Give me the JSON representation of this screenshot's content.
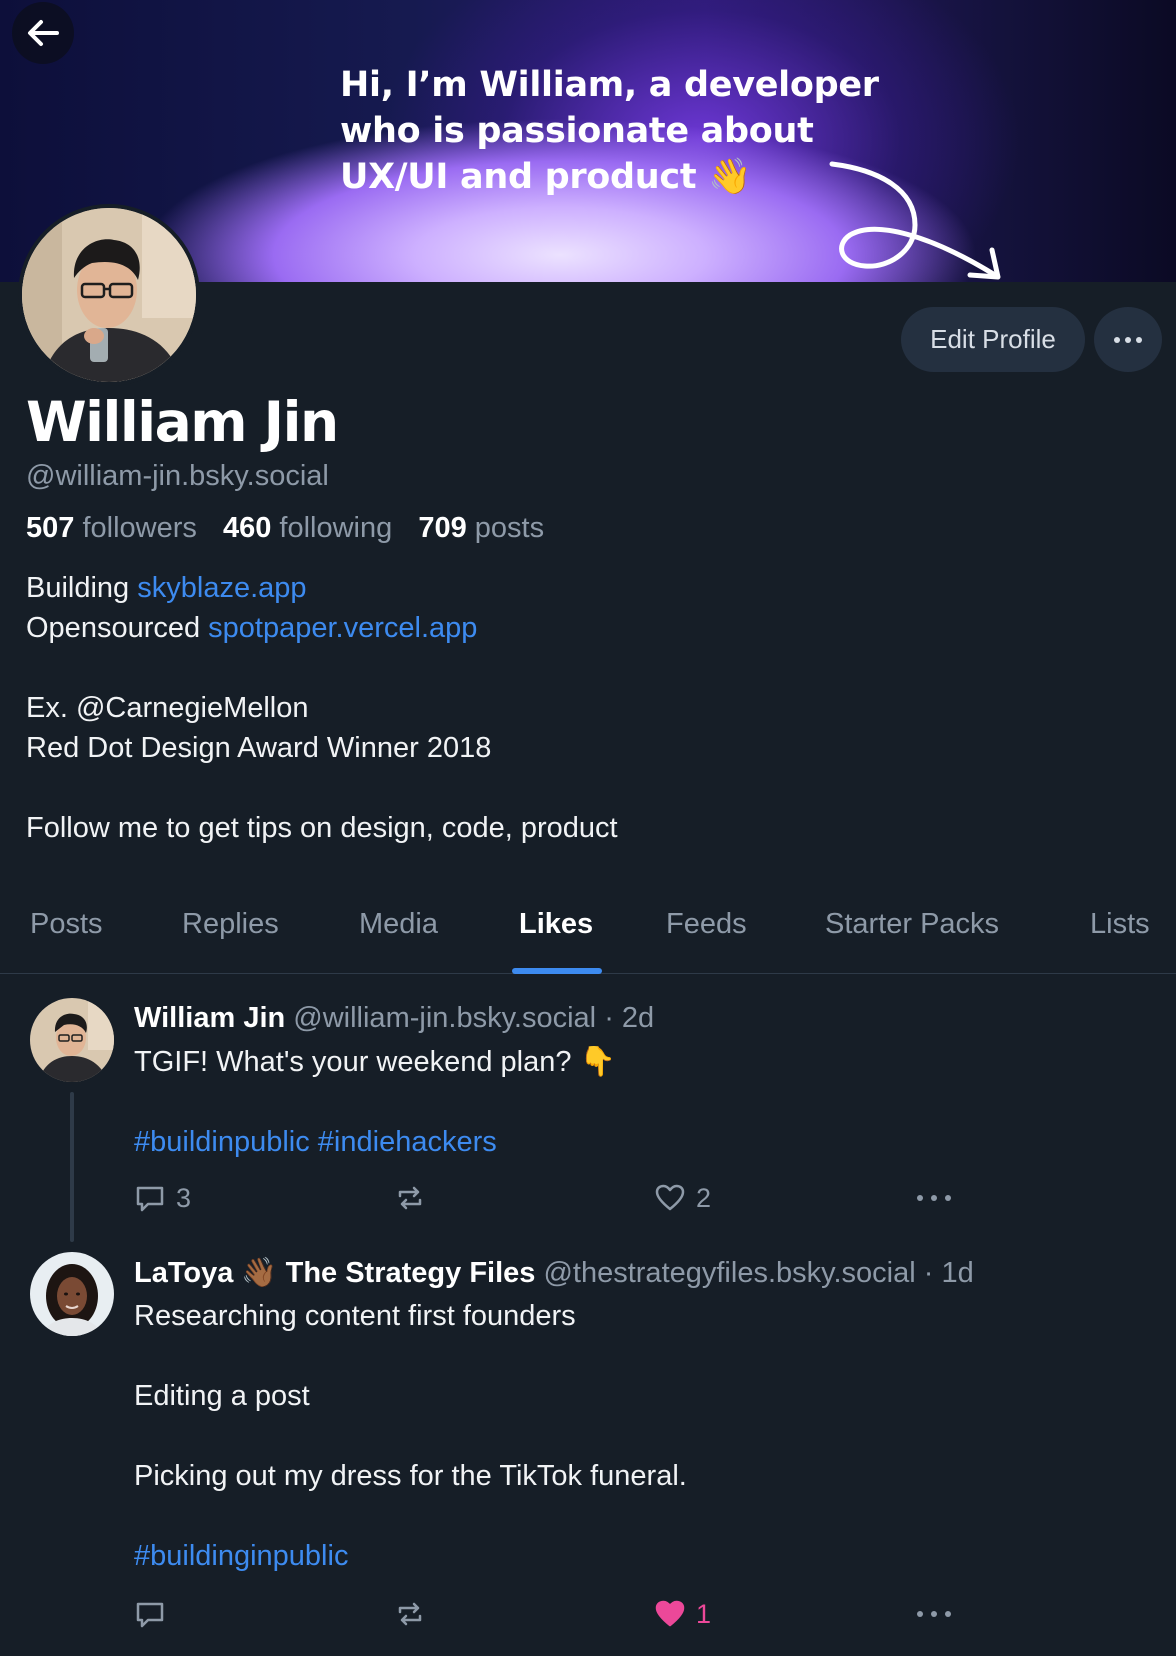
{
  "banner": {
    "text": "Hi, I’m William, a developer\nwho is passionate about\nUX/UI and product 👋"
  },
  "profile": {
    "name": "William Jin",
    "handle": "@william-jin.bsky.social",
    "edit_label": "Edit Profile",
    "stats": {
      "followers_count": "507",
      "followers_label": "followers",
      "following_count": "460",
      "following_label": "following",
      "posts_count": "709",
      "posts_label": "posts"
    },
    "bio": {
      "line1_prefix": "Building ",
      "line1_link": "skyblaze.app",
      "line2_prefix": "Opensourced ",
      "line2_link": "spotpaper.vercel.app",
      "line3": "Ex. @CarnegieMellon",
      "line4": "Red Dot Design Award Winner 2018",
      "line5": "Follow me to get tips on design, code, product"
    }
  },
  "tabs": [
    {
      "label": "Posts"
    },
    {
      "label": "Replies"
    },
    {
      "label": "Media"
    },
    {
      "label": "Likes",
      "active": true
    },
    {
      "label": "Feeds"
    },
    {
      "label": "Starter Packs"
    },
    {
      "label": "Lists"
    }
  ],
  "posts": [
    {
      "author": "William Jin",
      "handle": "@william-jin.bsky.social",
      "time": "· 2d",
      "text": "TGIF! What's your weekend plan? 👇",
      "tags": "#buildinpublic #indiehackers",
      "replies": "3",
      "reposts": "",
      "likes": "2",
      "liked": false
    },
    {
      "author": "LaToya 👋🏾 The Strategy Files",
      "handle": "@thestrategyfiles.bsky.social",
      "time": "· 1d",
      "line1": "Researching content first founders",
      "line2": "Editing a post",
      "line3": "Picking out my dress for the TikTok funeral.",
      "tags": "#buildinginpublic",
      "replies": "",
      "reposts": "",
      "likes": "1",
      "liked": true
    }
  ],
  "colors": {
    "background": "#161e27",
    "accent": "#3d8bf0",
    "like": "#ec4899",
    "muted": "#8e9aa8"
  },
  "icons": [
    "back-arrow-icon",
    "ellipsis-icon",
    "comment-icon",
    "repost-icon",
    "heart-icon"
  ]
}
